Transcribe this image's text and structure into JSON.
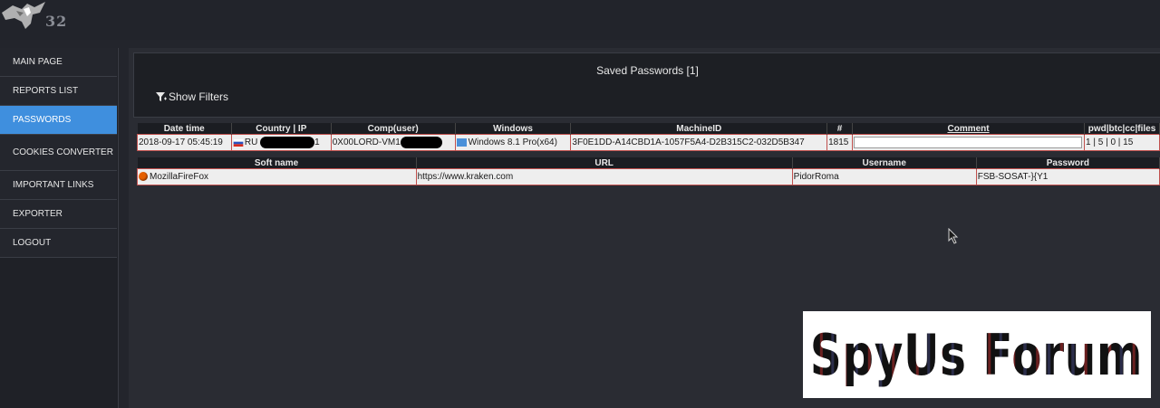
{
  "header": {
    "logo_number": "32"
  },
  "sidebar": {
    "items": [
      {
        "label": "MAIN PAGE"
      },
      {
        "label": "REPORTS LIST"
      },
      {
        "label": "PASSWORDS"
      },
      {
        "label": "COOKIES CONVERTER"
      },
      {
        "label": "IMPORTANT LINKS"
      },
      {
        "label": "EXPORTER"
      },
      {
        "label": "LOGOUT"
      }
    ],
    "active": "PASSWORDS"
  },
  "panel": {
    "title": "Saved Passwords [1]",
    "filters_label": "Show Filters"
  },
  "report_table": {
    "headers": [
      "Date time",
      "Country | IP",
      "Comp(user)",
      "Windows",
      "MachineID",
      "#",
      "Comment",
      "pwd|btc|cc|files"
    ],
    "row": {
      "datetime": "2018-09-17 05:45:19",
      "country": "RU",
      "ip_tail": "1",
      "comp_prefix": "0X00LORD-VM1",
      "windows": "Windows 8.1 Pro(x64)",
      "machine_id": "3F0E1DD-A14CBD1A-1057F5A4-D2B315C2-032D5B347",
      "number": "1815",
      "comment": "",
      "counts": "1 | 5 | 0 | 15"
    }
  },
  "password_table": {
    "headers": [
      "Soft name",
      "URL",
      "Username",
      "Password"
    ],
    "row": {
      "soft": "MozillaFireFox",
      "url": "https://www.kraken.com",
      "username": "PidorRoma",
      "password": "FSB-SOSAT-}{Y1"
    }
  },
  "watermark": {
    "text": "SpyUs Forum"
  },
  "colors": {
    "accent": "#3f8fde",
    "row_border": "#c0504d"
  }
}
